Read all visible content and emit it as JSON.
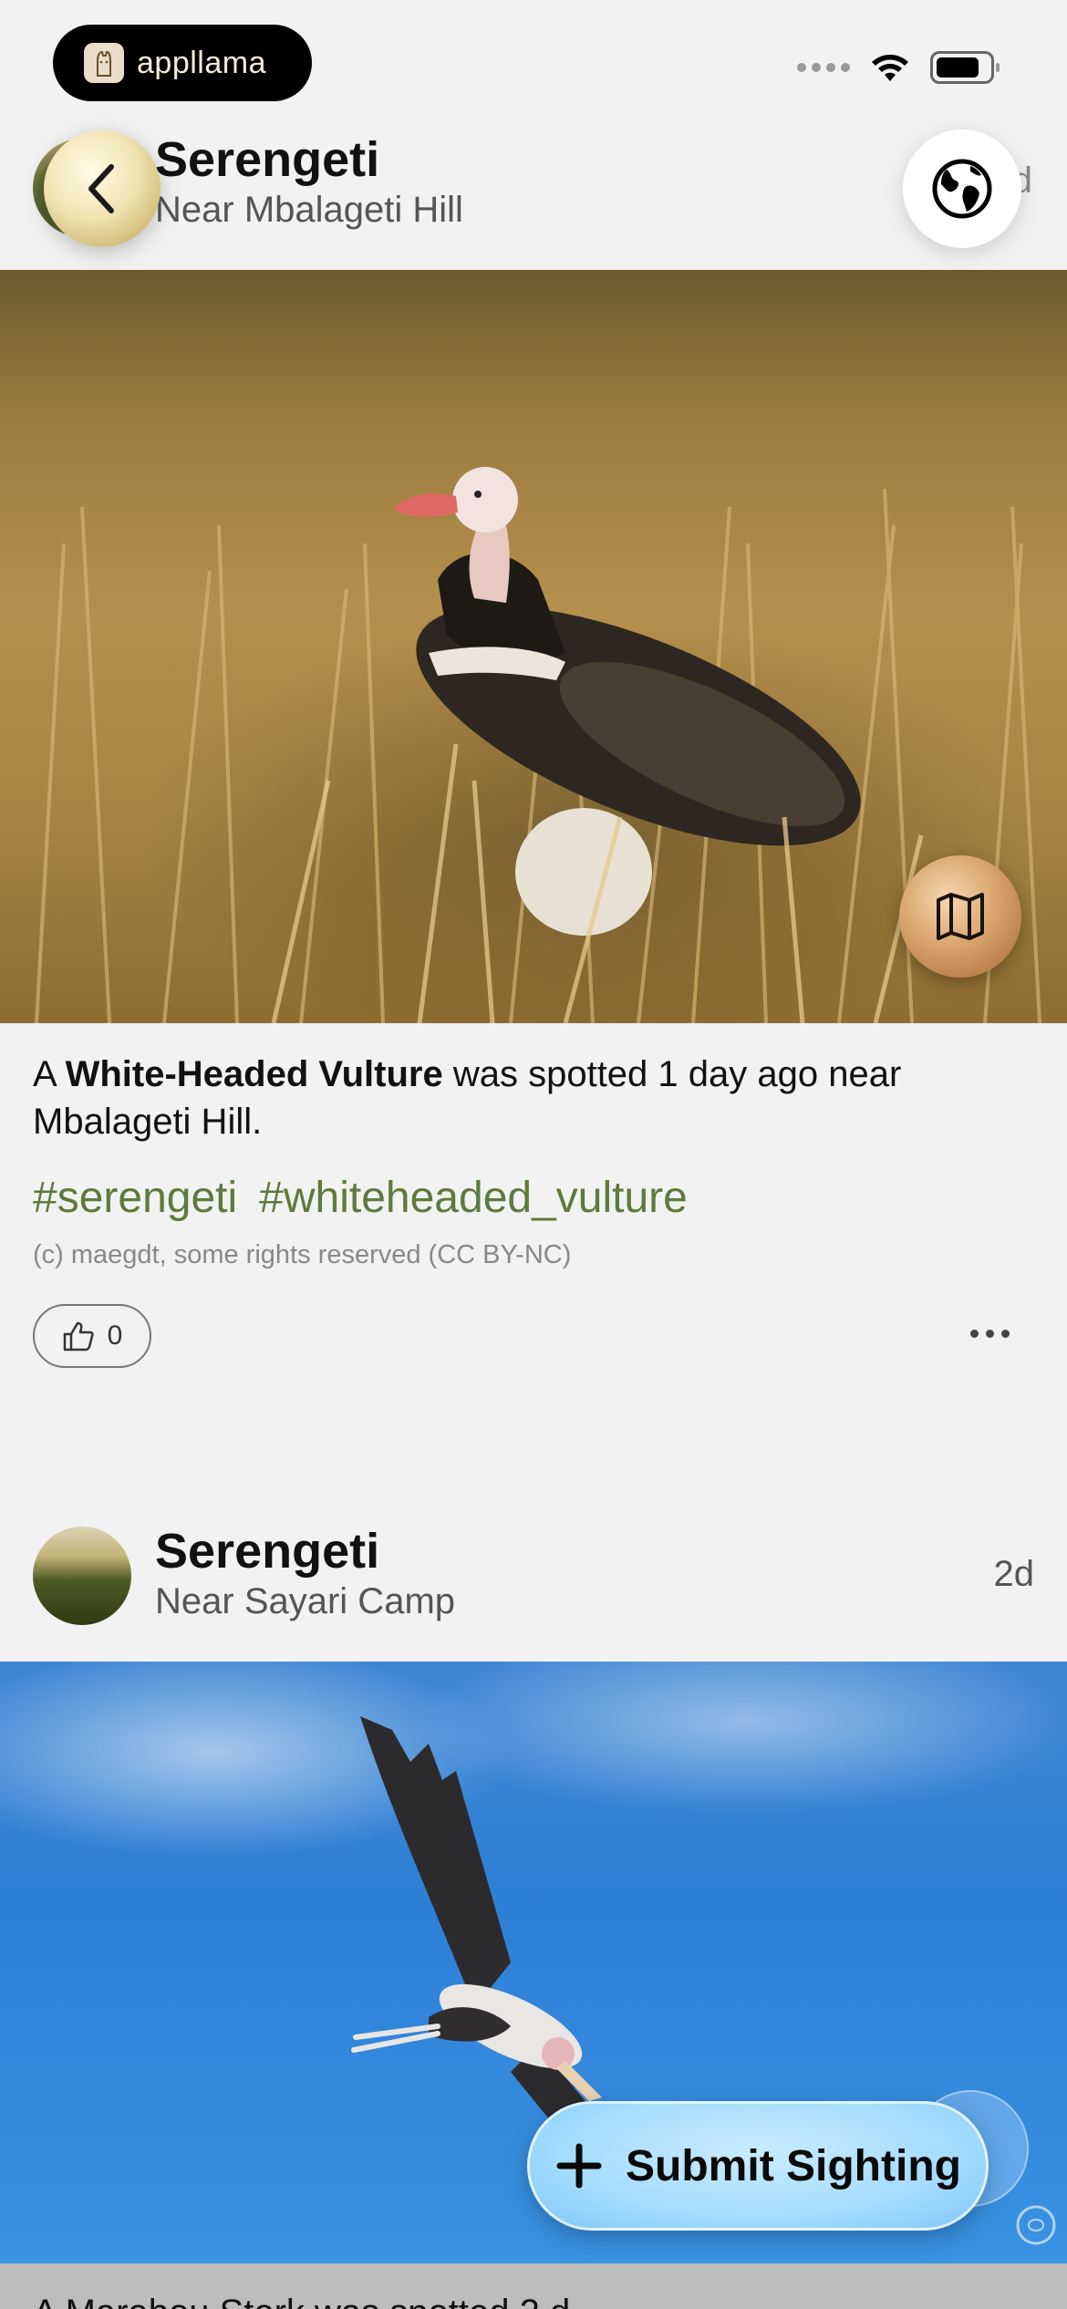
{
  "status_bar": {
    "app_badge": "appllama",
    "wifi_icon": "wifi-icon",
    "battery_icon": "battery-icon"
  },
  "nav": {
    "back_icon": "chevron-left-icon",
    "globe_icon": "globe-icon"
  },
  "posts": [
    {
      "title": "Serengeti",
      "subtitle": "Near Mbalageti Hill",
      "age": "1d",
      "caption": {
        "prefix": "A",
        "species": "White-Headed Vulture",
        "rest": "was spotted 1 day ago near Mbalageti Hill."
      },
      "tags": [
        "#serengeti",
        "#whiteheaded_vulture"
      ],
      "credit": "(c) maegdt, some rights reserved (CC BY-NC)",
      "likes": "0",
      "map_icon": "map-icon"
    },
    {
      "title": "Serengeti",
      "subtitle": "Near Sayari Camp",
      "age": "2d",
      "caption_partial": "A Marabou Stork was spotted 2 d"
    }
  ],
  "submit_button": {
    "label": "Submit Sighting",
    "icon": "plus-icon"
  }
}
